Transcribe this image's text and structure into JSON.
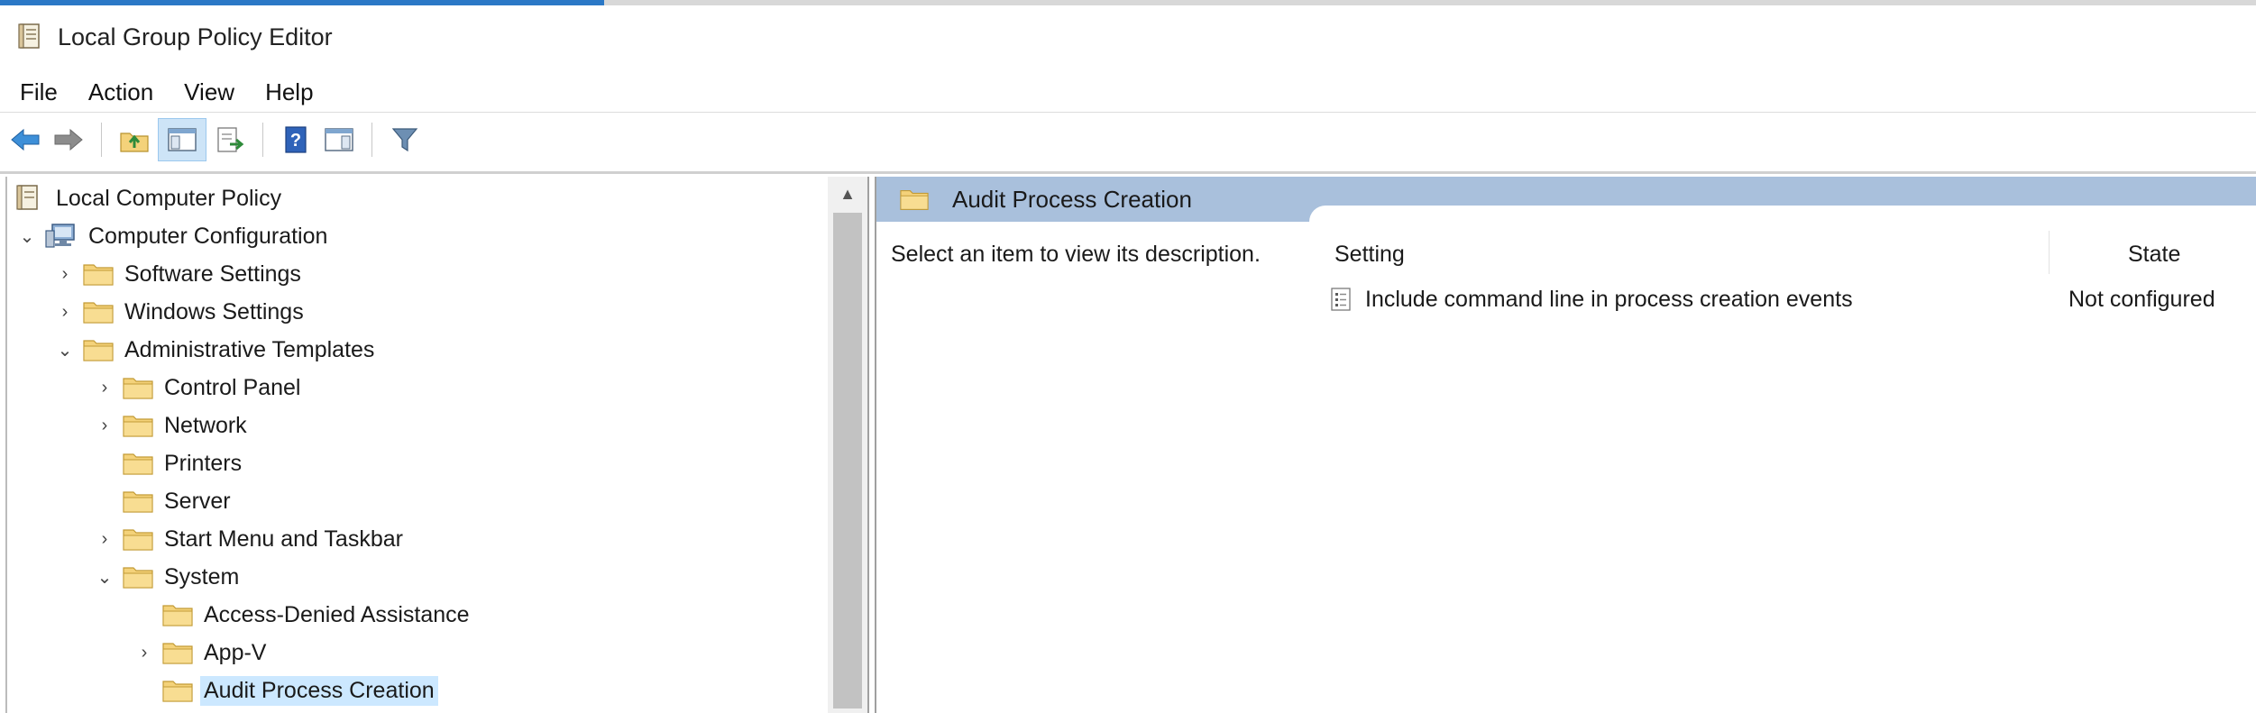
{
  "window": {
    "title": "Local Group Policy Editor"
  },
  "menu": [
    "File",
    "Action",
    "View",
    "Help"
  ],
  "toolbar": {
    "buttons": [
      "back-arrow-icon",
      "forward-arrow-icon",
      "up-folder-icon",
      "show-hide-tree-icon",
      "export-list-icon",
      "help-icon",
      "show-hide-action-pane-icon",
      "filter-icon"
    ]
  },
  "tree": {
    "root": "Local Computer Policy",
    "computer_config": "Computer Configuration",
    "software_settings": "Software Settings",
    "windows_settings": "Windows Settings",
    "admin_templates": "Administrative Templates",
    "control_panel": "Control Panel",
    "network": "Network",
    "printers": "Printers",
    "server": "Server",
    "start_menu": "Start Menu and Taskbar",
    "system": "System",
    "access_denied": "Access-Denied Assistance",
    "app_v": "App-V",
    "audit_process": "Audit Process Creation"
  },
  "details": {
    "header": "Audit Process Creation",
    "description": "Select an item to view its description.",
    "columns": {
      "setting": "Setting",
      "state": "State"
    },
    "rows": [
      {
        "setting": "Include command line in process creation events",
        "state": "Not configured"
      }
    ]
  },
  "colors": {
    "accent": "#2b78c6",
    "header_bg": "#a9c0dc",
    "selection": "#cce8ff",
    "folder": "#f4d27a"
  }
}
